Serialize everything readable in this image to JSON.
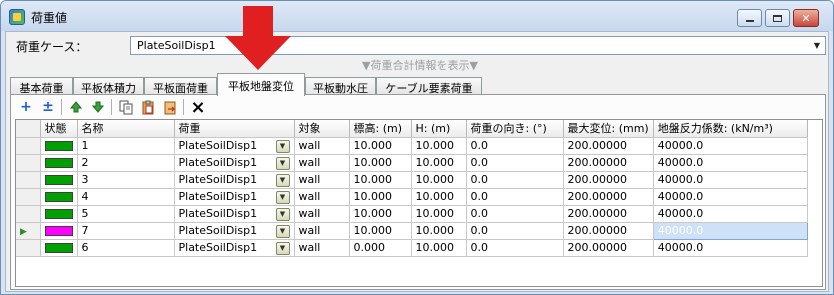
{
  "window": {
    "title": "荷重値",
    "min_icon": "minimize-icon",
    "max_icon": "maximize-icon",
    "close_icon": "close-icon"
  },
  "load_case": {
    "label": "荷重ケース：",
    "value": "PlateSoilDisp1"
  },
  "summary_toggle": "▼荷重合計情報を表示▼",
  "tabs": [
    {
      "label": "基本荷重"
    },
    {
      "label": "平板体積力"
    },
    {
      "label": "平板面荷重"
    },
    {
      "label": "平板地盤変位",
      "active": true
    },
    {
      "label": "平板動水圧"
    },
    {
      "label": "ケーブル要素荷重"
    }
  ],
  "toolbar": {
    "add": "+",
    "insert": "±",
    "move_up": "move-up-icon",
    "move_down": "move-down-icon",
    "copy": "copy-icon",
    "paste": "paste-icon",
    "paste_special": "paste-special-icon",
    "delete": "×"
  },
  "table": {
    "headers": [
      "状態",
      "名称",
      "荷重",
      "対象",
      "標高: (m)",
      "H: (m)",
      "荷重の向き: (°)",
      "最大変位: (mm)",
      "地盤反力係数: (kN/m³)"
    ],
    "rows": [
      {
        "status_color": "#00a000",
        "name": "1",
        "load": "PlateSoilDisp1",
        "target": "wall",
        "elev": "10.000",
        "h": "10.000",
        "dir": "0.0",
        "maxdisp": "200.00000",
        "k": "40000.0"
      },
      {
        "status_color": "#00a000",
        "name": "2",
        "load": "PlateSoilDisp1",
        "target": "wall",
        "elev": "10.000",
        "h": "10.000",
        "dir": "0.0",
        "maxdisp": "200.00000",
        "k": "40000.0"
      },
      {
        "status_color": "#00a000",
        "name": "3",
        "load": "PlateSoilDisp1",
        "target": "wall",
        "elev": "10.000",
        "h": "10.000",
        "dir": "0.0",
        "maxdisp": "200.00000",
        "k": "40000.0"
      },
      {
        "status_color": "#00a000",
        "name": "4",
        "load": "PlateSoilDisp1",
        "target": "wall",
        "elev": "10.000",
        "h": "10.000",
        "dir": "0.0",
        "maxdisp": "200.00000",
        "k": "40000.0"
      },
      {
        "status_color": "#00a000",
        "name": "5",
        "load": "PlateSoilDisp1",
        "target": "wall",
        "elev": "10.000",
        "h": "10.000",
        "dir": "0.0",
        "maxdisp": "200.00000",
        "k": "40000.0"
      },
      {
        "status_color": "#ff00ff",
        "name": "7",
        "load": "PlateSoilDisp1",
        "target": "wall",
        "elev": "10.000",
        "h": "10.000",
        "dir": "0.0",
        "maxdisp": "200.00000",
        "k": "40000.0",
        "current": true
      },
      {
        "status_color": "#00a000",
        "name": "6",
        "load": "PlateSoilDisp1",
        "target": "wall",
        "elev": "0.000",
        "h": "10.000",
        "dir": "0.0",
        "maxdisp": "200.00000",
        "k": "40000.0"
      }
    ]
  },
  "colors": {
    "annotation_arrow": "#e02020",
    "selected_cell": "#cfe1f7"
  }
}
